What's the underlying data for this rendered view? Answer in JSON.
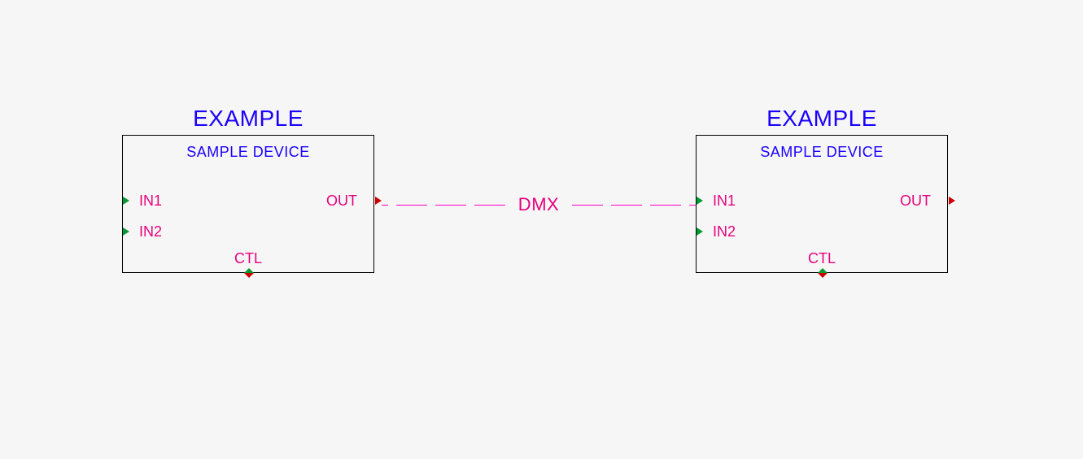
{
  "devices": [
    {
      "title": "EXAMPLE",
      "subtitle": "SAMPLE DEVICE",
      "ports": {
        "in1": "IN1",
        "in2": "IN2",
        "out": "OUT",
        "ctl": "CTL"
      }
    },
    {
      "title": "EXAMPLE",
      "subtitle": "SAMPLE DEVICE",
      "ports": {
        "in1": "IN1",
        "in2": "IN2",
        "out": "OUT",
        "ctl": "CTL"
      }
    }
  ],
  "connection": {
    "label": "DMX",
    "type": "dashed",
    "color": "#ff00c8"
  },
  "colors": {
    "title": "#1a00ff",
    "port": "#e6007e",
    "line": "#ff00c8",
    "marker_in": "#009933",
    "marker_out": "#cc0000",
    "marker_ctl_top": "#009933",
    "marker_ctl_bottom": "#cc0000"
  }
}
